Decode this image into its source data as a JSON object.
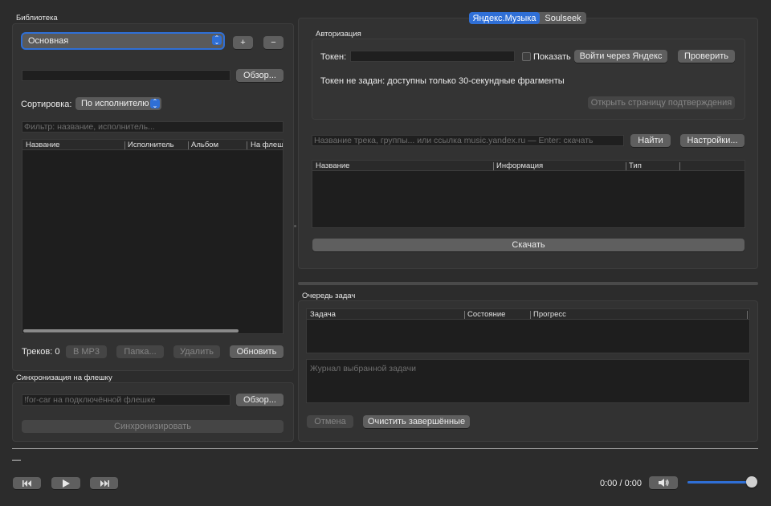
{
  "library": {
    "title": "Библиотека",
    "collection_value": "Основная",
    "add_label": "+",
    "remove_label": "−",
    "path_value": "",
    "browse_label": "Обзор...",
    "sort_label": "Сортировка:",
    "sort_value": "По исполнителю",
    "filter_placeholder": "Фильтр: название, исполнитель...",
    "columns": [
      "Название",
      "Исполнитель",
      "Альбом",
      "На флешке"
    ],
    "tracks_label": "Треков: 0",
    "to_mp3_label": "В MP3",
    "folder_label": "Папка...",
    "delete_label": "Удалить",
    "refresh_label": "Обновить"
  },
  "sync": {
    "title": "Синхронизация на флешку",
    "path_placeholder": "!for-car на подключённой флешке",
    "browse_label": "Обзор...",
    "sync_label": "Синхронизировать"
  },
  "tabs": {
    "yandex_label": "Яндекс.Музыка",
    "soulseek_label": "Soulseek"
  },
  "auth": {
    "title": "Авторизация",
    "token_label": "Токен:",
    "show_label": "Показать",
    "login_label": "Войти через Яндекс",
    "check_label": "Проверить",
    "status_text": "Токен не задан: доступны только 30-секундные фрагменты",
    "open_confirm_label": "Открыть страницу подтверждения"
  },
  "search": {
    "placeholder": "Название трека, группы... или ссылка music.yandex.ru — Enter: скачать",
    "find_label": "Найти",
    "settings_label": "Настройки...",
    "columns": [
      "Название",
      "Информация",
      "Тип"
    ],
    "download_label": "Скачать"
  },
  "queue": {
    "title": "Очередь задач",
    "columns": [
      "Задача",
      "Состояние",
      "Прогресс"
    ],
    "log_placeholder": "Журнал выбранной задачи",
    "cancel_label": "Отмена",
    "clear_label": "Очистить завершённые"
  },
  "player": {
    "now_playing": "—",
    "time_text": "0:00 / 0:00",
    "volume_level": 1.0,
    "prev_icon": "previous-track-icon",
    "play_icon": "play-icon",
    "next_icon": "next-track-icon",
    "volume_icon": "speaker-icon"
  },
  "colors": {
    "accent": "#2f6fd6",
    "background": "#2c2c2c"
  }
}
